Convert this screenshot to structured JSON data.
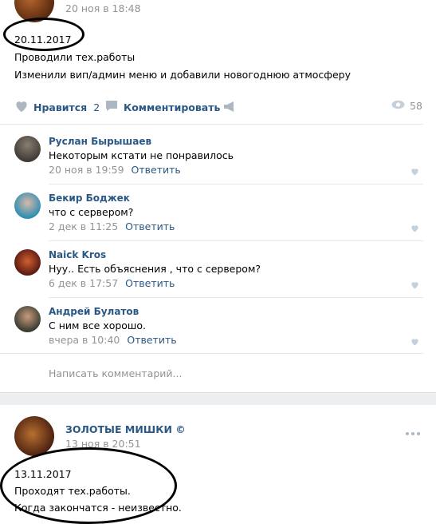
{
  "post1": {
    "date_meta": "20 ноя в 18:48",
    "lines": [
      "20.11.2017",
      "Проводили тех.работы",
      "Изменили вип/админ меню и добавили новогоднюю атмосферу"
    ],
    "actions": {
      "like_label": "Нравится",
      "like_count": "2",
      "comment_label": "Комментировать",
      "views": "58"
    },
    "comments": [
      {
        "author": "Руслан Бырышаев",
        "text": "Некоторым кстати не понравилось",
        "time": "20 ноя в 19:59",
        "reply": "Ответить"
      },
      {
        "author": "Бекир Боджек",
        "text": "что с сервером?",
        "time": "2 дек в 11:25",
        "reply": "Ответить"
      },
      {
        "author": "Naick Kros",
        "text": "Нуу.. Есть объяснения , что с сервером?",
        "time": "6 дек в 17:57",
        "reply": "Ответить"
      },
      {
        "author": "Андрей Булатов",
        "text": "С ним все хорошо.",
        "time": "вчера в 10:40",
        "reply": "Ответить"
      }
    ],
    "comment_placeholder": "Написать комментарий..."
  },
  "post2": {
    "author": "ЗОЛОТЫЕ МИШКИ ©",
    "date_meta": "13 ноя в 20:51",
    "lines": [
      "13.11.2017",
      "Проходят тех.работы.",
      "Когда закончатся - неизвестно."
    ]
  },
  "colors": {
    "link": "#2a5885",
    "muted": "#939393",
    "icon": "#adb7c2",
    "divider": "#e7e8ec",
    "gap": "#edeef0"
  }
}
